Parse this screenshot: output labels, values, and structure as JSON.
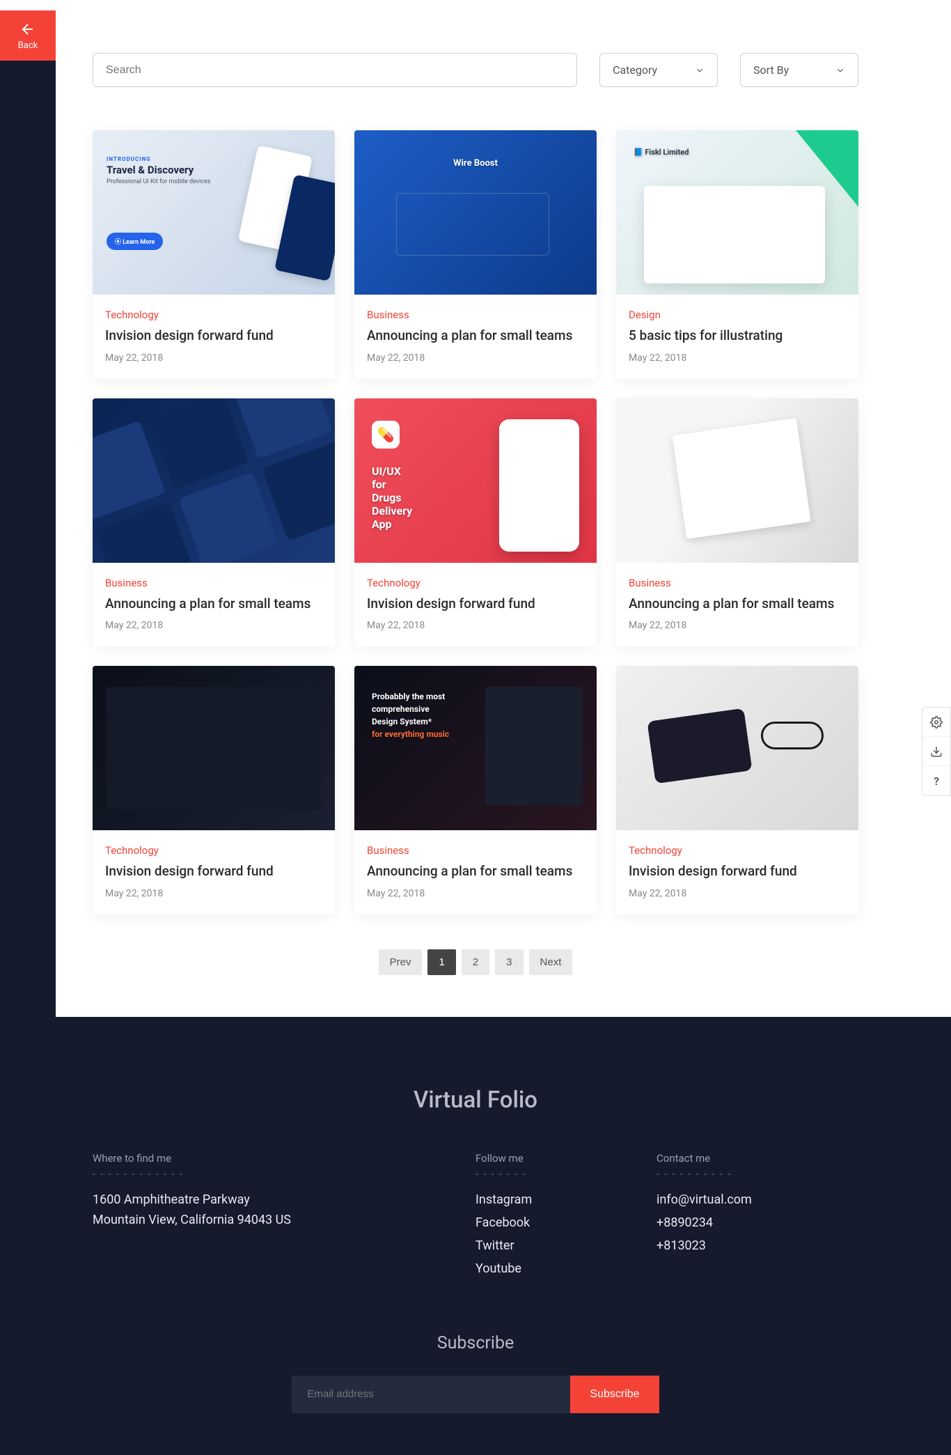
{
  "back": {
    "label": "Back"
  },
  "controls": {
    "search_placeholder": "Search",
    "category_label": "Category",
    "sort_label": "Sort By"
  },
  "cards": [
    {
      "cat": "Technology",
      "title": "Invision design forward fund",
      "date": "May 22, 2018",
      "thumb": {
        "headline": "Travel & Discovery",
        "sub": "Professional UI Kit for mobile devices",
        "kicker": "INTRODUCING",
        "cta": "Learn More"
      }
    },
    {
      "cat": "Business",
      "title": "Announcing a plan for small teams",
      "date": "May 22, 2018",
      "thumb": {
        "headline": "Wire Boost"
      }
    },
    {
      "cat": "Design",
      "title": "5 basic tips for illustrating",
      "date": "May 22, 2018",
      "thumb": {
        "headline": "Fiskl Limited"
      }
    },
    {
      "cat": "Business",
      "title": "Announcing a plan for small teams",
      "date": "May 22, 2018"
    },
    {
      "cat": "Technology",
      "title": "Invision design forward fund",
      "date": "May 22, 2018",
      "thumb": {
        "headline": "UI/UX for Drugs Delivery App"
      }
    },
    {
      "cat": "Business",
      "title": "Announcing a plan for small teams",
      "date": "May 22, 2018"
    },
    {
      "cat": "Technology",
      "title": "Invision design forward fund",
      "date": "May 22, 2018"
    },
    {
      "cat": "Business",
      "title": "Announcing a plan for small teams",
      "date": "May 22, 2018",
      "thumb": {
        "line1": "Probabbly the most",
        "line2": "comprehensive",
        "line3": "Design System*",
        "line4": "for everything music"
      }
    },
    {
      "cat": "Technology",
      "title": "Invision design forward fund",
      "date": "May 22, 2018"
    }
  ],
  "pagination": {
    "prev": "Prev",
    "pages": [
      "1",
      "2",
      "3"
    ],
    "next": "Next",
    "active": 0
  },
  "footer": {
    "logo": "Virtual Folio",
    "find_h": "Where to find me",
    "addr1": "1600 Amphitheatre Parkway",
    "addr2": "Mountain View, California 94043 US",
    "follow_h": "Follow me",
    "socials": [
      "Instagram",
      "Facebook",
      "Twitter",
      "Youtube"
    ],
    "contact_h": "Contact me",
    "contacts": [
      "info@virtual.com",
      "+8890234",
      "+813023"
    ],
    "subscribe_h": "Subscribe",
    "email_placeholder": "Email address",
    "subscribe_btn": "Subscribe"
  }
}
